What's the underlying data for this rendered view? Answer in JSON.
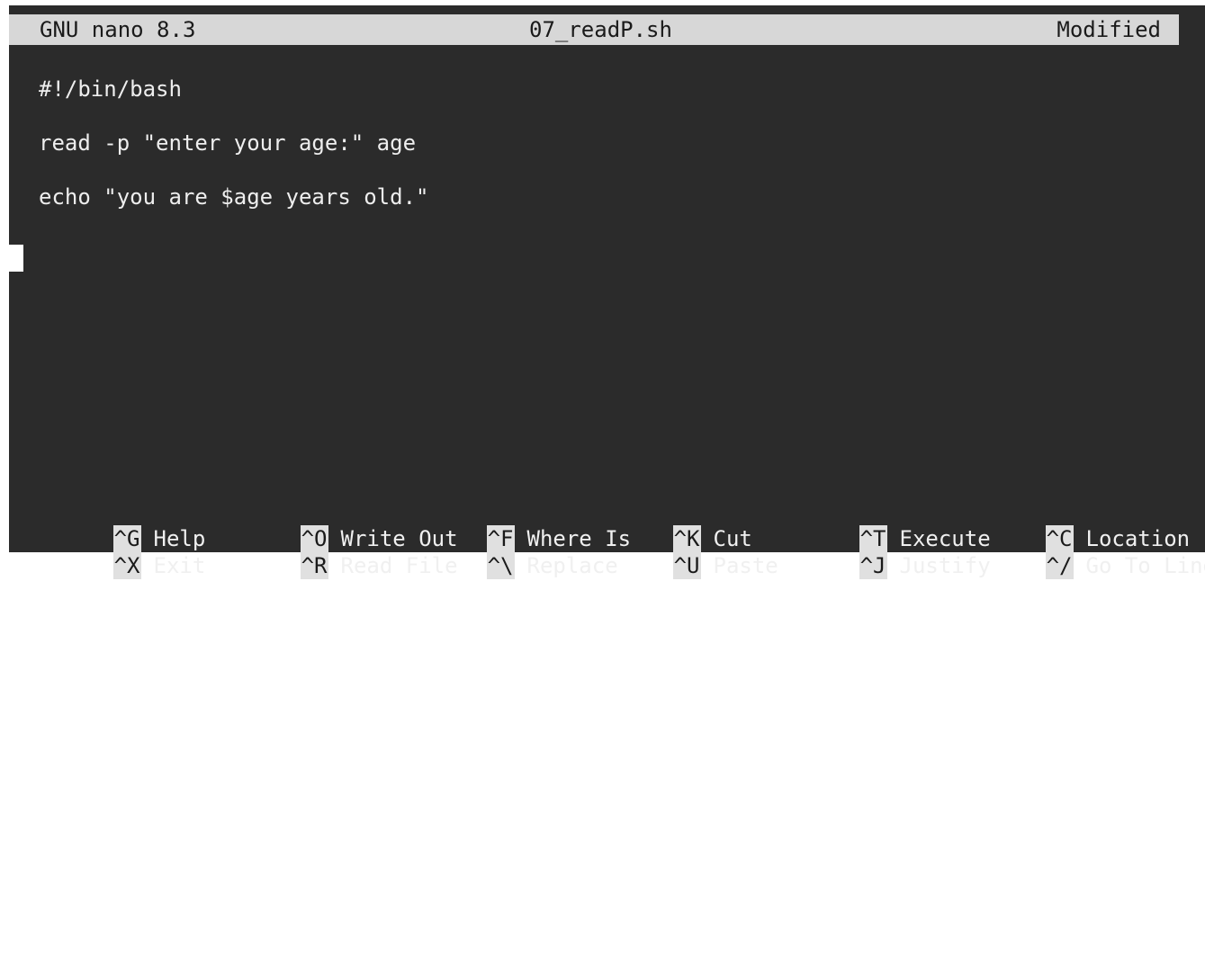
{
  "titlebar": {
    "app_name": "GNU nano 8.3",
    "file_name": "07_readP.sh",
    "status": "Modified"
  },
  "editor": {
    "lines": [
      "#!/bin/bash",
      "read -p \"enter your age:\" age",
      "echo \"you are $age years old.\""
    ]
  },
  "shortcuts": {
    "row1": [
      {
        "key": "^G",
        "label": "Help"
      },
      {
        "key": "^O",
        "label": "Write Out"
      },
      {
        "key": "^F",
        "label": "Where Is"
      },
      {
        "key": "^K",
        "label": "Cut"
      },
      {
        "key": "^T",
        "label": "Execute"
      },
      {
        "key": "^C",
        "label": "Location"
      }
    ],
    "row2": [
      {
        "key": "^X",
        "label": "Exit"
      },
      {
        "key": "^R",
        "label": "Read File"
      },
      {
        "key": "^\\",
        "label": "Replace"
      },
      {
        "key": "^U",
        "label": "Paste"
      },
      {
        "key": "^J",
        "label": "Justify"
      },
      {
        "key": "^/",
        "label": "Go To Line"
      }
    ]
  },
  "colors": {
    "background": "#2b2b2b",
    "titlebar": "#d7d7d7",
    "text": "#eeeeee"
  }
}
